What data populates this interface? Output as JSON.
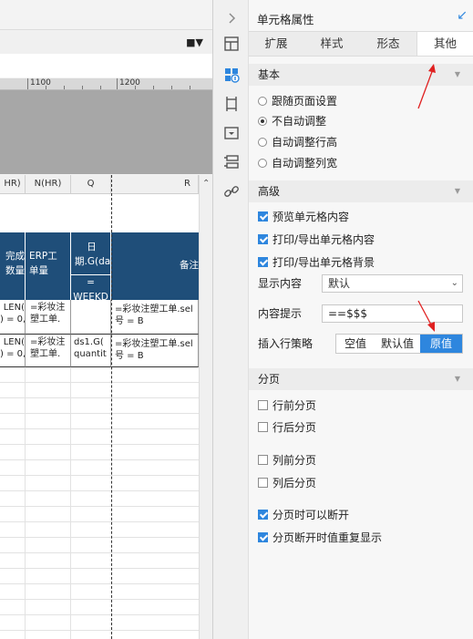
{
  "spreadsheet": {
    "ruler_labels": [
      "1100",
      "1200"
    ],
    "column_headers": [
      "HR)",
      "N(HR)",
      "Q",
      "R"
    ],
    "header_cells": {
      "col1": "完成数量",
      "col2": "ERP工单量",
      "col3_top": "日期.G(day)",
      "col3_bottom": "= WEEKD",
      "col4": "备注"
    },
    "data_rows": [
      {
        "c1": "LEN(\n) = 0,",
        "c2": "=彩妆注塑工单.",
        "c3": "",
        "c4": "=彩妆注塑工单.sel\n号 = B"
      },
      {
        "c1": "LEN(\n) = 0,",
        "c2": "=彩妆注塑工单.",
        "c3": "ds1.G(\nquantit",
        "c4": "=彩妆注塑工单.sel\n号 = B"
      }
    ]
  },
  "panel": {
    "title": "单元格属性",
    "tabs": [
      "扩展",
      "样式",
      "形态",
      "其他"
    ],
    "active_tab": "其他",
    "sections": {
      "basic": {
        "title": "基本",
        "options": [
          "跟随页面设置",
          "不自动调整",
          "自动调整行高",
          "自动调整列宽"
        ],
        "selected_index": 1
      },
      "advanced": {
        "title": "高级",
        "checks": [
          {
            "label": "预览单元格内容",
            "checked": true
          },
          {
            "label": "打印/导出单元格内容",
            "checked": true
          },
          {
            "label": "打印/导出单元格背景",
            "checked": true
          }
        ],
        "display_label": "显示内容",
        "display_value": "默认",
        "hint_label": "内容提示",
        "hint_value": "==$$$",
        "insert_label": "插入行策略",
        "insert_options": [
          "空值",
          "默认值",
          "原值"
        ],
        "insert_selected": "原值"
      },
      "paging": {
        "title": "分页",
        "checks": [
          {
            "label": "行前分页",
            "checked": false
          },
          {
            "label": "行后分页",
            "checked": false
          },
          {
            "label": "列前分页",
            "checked": false
          },
          {
            "label": "列后分页",
            "checked": false
          },
          {
            "label": "分页时可以断开",
            "checked": true
          },
          {
            "label": "分页断开时值重复显示",
            "checked": true
          }
        ]
      }
    }
  },
  "colors": {
    "accent": "#2e86de",
    "header_fill": "#1f4e79",
    "annotation_red": "#e02020"
  }
}
